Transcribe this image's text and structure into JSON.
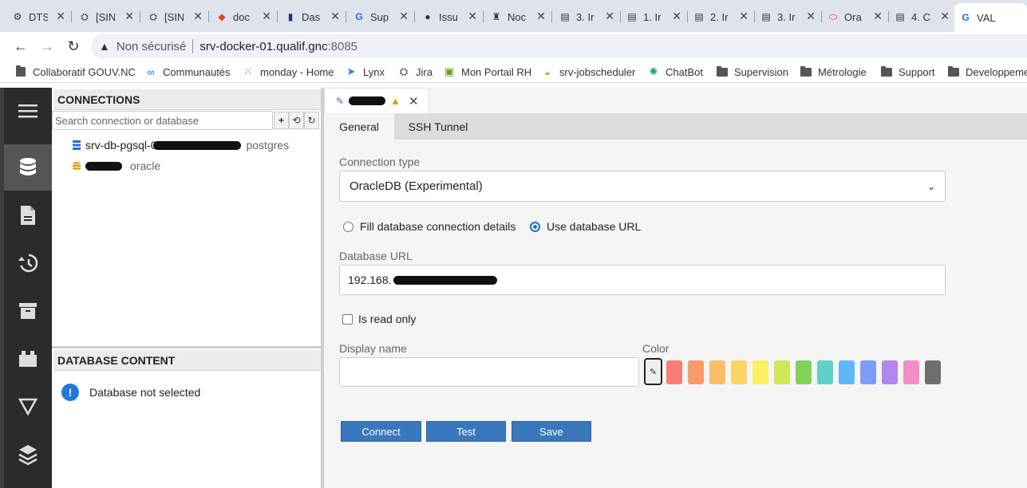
{
  "browser": {
    "tabs": [
      {
        "label": "DTS",
        "icon": "dts-favicon-icon"
      },
      {
        "label": "[SIN",
        "icon": "jira-favicon-icon"
      },
      {
        "label": "[SIN",
        "icon": "jira-favicon-icon"
      },
      {
        "label": "doc",
        "icon": "gitlab-favicon-icon"
      },
      {
        "label": "Das",
        "icon": "dashboard-favicon-icon"
      },
      {
        "label": "Sup",
        "icon": "g-favicon-icon"
      },
      {
        "label": "Issu",
        "icon": "github-favicon-icon"
      },
      {
        "label": "Noc",
        "icon": "nocodb-favicon-icon"
      },
      {
        "label": "3. Ir",
        "icon": "doc-favicon-icon"
      },
      {
        "label": "1. Ir",
        "icon": "doc-favicon-icon"
      },
      {
        "label": "2. Ir",
        "icon": "doc-favicon-icon"
      },
      {
        "label": "3. Ir",
        "icon": "doc-favicon-icon"
      },
      {
        "label": "Ora",
        "icon": "oracle-favicon-icon"
      },
      {
        "label": "4. C",
        "icon": "doc-favicon-icon"
      },
      {
        "label": "VAL",
        "icon": "g-favicon-icon",
        "active": true
      }
    ],
    "address": {
      "security_label": "Non sécurisé",
      "host": "srv-docker-01.qualif.gnc",
      "port": ":8085"
    },
    "bookmarks": [
      {
        "label": "Collaboratif GOUV.NC",
        "icon": "page-icon"
      },
      {
        "label": "Communautés",
        "icon": "meta-icon"
      },
      {
        "label": "monday - Home",
        "icon": "monday-icon"
      },
      {
        "label": "Lynx",
        "icon": "send-icon"
      },
      {
        "label": "Jira",
        "icon": "jira-icon"
      },
      {
        "label": "Mon Portail RH",
        "icon": "portal-icon"
      },
      {
        "label": "srv-jobscheduler",
        "icon": "scheduler-icon"
      },
      {
        "label": "ChatBot",
        "icon": "chatgpt-icon"
      },
      {
        "label": "Supervision",
        "icon": "folder-icon"
      },
      {
        "label": "Métrologie",
        "icon": "folder-icon"
      },
      {
        "label": "Support",
        "icon": "folder-icon"
      },
      {
        "label": "Developpeme",
        "icon": "folder-icon"
      }
    ]
  },
  "connections": {
    "header": "CONNECTIONS",
    "search_placeholder": "Search connection or database",
    "items": [
      {
        "name": "srv-db-pgsql-0",
        "type": "postgres"
      },
      {
        "name": "",
        "type": "oracle"
      }
    ]
  },
  "database_content": {
    "header": "DATABASE CONTENT",
    "notice": "Database not selected"
  },
  "editor": {
    "tab_label": "",
    "subtabs": [
      "General",
      "SSH Tunnel"
    ],
    "connection_type_label": "Connection type",
    "connection_type_value": "OracleDB (Experimental)",
    "radio_fill": "Fill database connection details",
    "radio_url": "Use database URL",
    "database_url_label": "Database URL",
    "database_url_value": "192.168.",
    "readonly_label": "Is read only",
    "display_name_label": "Display name",
    "color_label": "Color",
    "swatches": [
      "#fa7c73",
      "#fa9a6a",
      "#fbbd67",
      "#fcd365",
      "#fdf061",
      "#cfe85a",
      "#7fd35b",
      "#5fd1c9",
      "#5fb7f8",
      "#7f9cf5",
      "#b385ee",
      "#f58dc6",
      "#6e6e6e"
    ],
    "buttons": {
      "connect": "Connect",
      "test": "Test",
      "save": "Save"
    }
  }
}
